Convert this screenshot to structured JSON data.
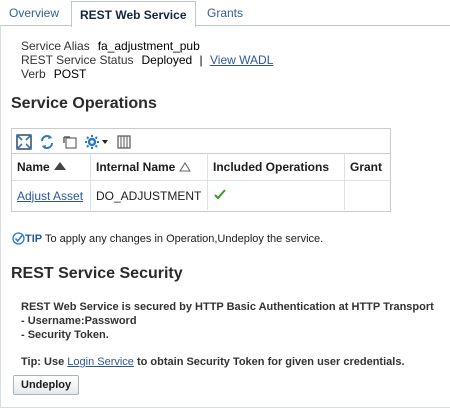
{
  "tabs": [
    {
      "label": "Overview"
    },
    {
      "label": "REST Web Service"
    },
    {
      "label": "Grants"
    }
  ],
  "service": {
    "alias_label": "Service Alias",
    "alias_value": "fa_adjustment_pub",
    "status_label": "REST Service Status",
    "status_value": "Deployed",
    "status_sep": "|",
    "wadl_link": "View WADL",
    "verb_label": "Verb",
    "verb_value": "POST"
  },
  "operations": {
    "heading": "Service Operations",
    "columns": [
      "Name",
      "Internal Name",
      "Included Operations",
      "Grant"
    ],
    "rows": [
      {
        "name": "Adjust Asset",
        "internal": "DO_ADJUSTMENT",
        "included": true,
        "grant": ""
      }
    ],
    "tip_label": "TIP",
    "tip_text": " To apply any changes in Operation,Undeploy the service."
  },
  "security": {
    "heading": "REST Service Security",
    "line1": "REST Web Service is secured by HTTP Basic Authentication at HTTP Transport",
    "line2": "- Username:Password",
    "line3": "- Security Token.",
    "tip_prefix": "Tip: Use ",
    "tip_link": "Login Service",
    "tip_suffix": " to obtain Security Token for given user credentials.",
    "undeploy_label": "Undeploy"
  },
  "colors": {
    "link": "#2b579a",
    "check": "#3a9a2a",
    "toolbar_blue": "#2a78c8"
  }
}
